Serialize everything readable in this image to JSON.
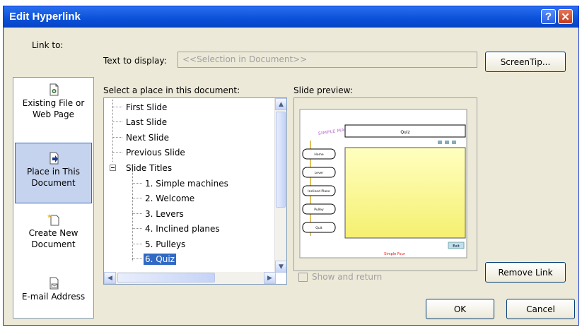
{
  "window": {
    "title": "Edit Hyperlink",
    "help_glyph": "?",
    "close_glyph": "✕"
  },
  "link_to": {
    "label": "Link to:",
    "items": [
      {
        "label_line1": "Existing File or",
        "label_line2": "Web Page",
        "icon": "existing-file-icon",
        "selected": false
      },
      {
        "label_line1": "Place in This",
        "label_line2": "Document",
        "icon": "place-in-document-icon",
        "selected": true
      },
      {
        "label_line1": "Create New",
        "label_line2": "Document",
        "icon": "new-document-icon",
        "selected": false
      },
      {
        "label_line1": "E-mail Address",
        "label_line2": "",
        "icon": "email-icon",
        "selected": false
      }
    ]
  },
  "text_to_display": {
    "label": "Text to display:",
    "value": "<<Selection in Document>>"
  },
  "screentip_label": "ScreenTip...",
  "place": {
    "label": "Select a place in this document:",
    "items": [
      {
        "text": "First Slide",
        "selected": false
      },
      {
        "text": "Last Slide",
        "selected": false
      },
      {
        "text": "Next Slide",
        "selected": false
      },
      {
        "text": "Previous Slide",
        "selected": false
      },
      {
        "text": "Slide Titles",
        "selected": false
      },
      {
        "text": "1. Simple machines",
        "selected": false
      },
      {
        "text": "2. Welcome",
        "selected": false
      },
      {
        "text": "3. Levers",
        "selected": false
      },
      {
        "text": "4. Inclined planes",
        "selected": false
      },
      {
        "text": "5. Pulleys",
        "selected": false
      },
      {
        "text": "6. Quiz",
        "selected": true
      }
    ]
  },
  "preview": {
    "label": "Slide preview:",
    "slide_title": "Quiz",
    "nav_buttons": [
      "Home",
      "Lever",
      "Inclined Plane",
      "Pulley",
      "Quit"
    ],
    "exit_label": "Exit",
    "footer_text": "Simple Four",
    "logo_text": "SIMPLE MACHINES",
    "colors": {
      "panel_top": "#ffffc0",
      "panel_bottom": "#f5f070",
      "footer": "#e81010",
      "logo": "#d0a0e0"
    }
  },
  "show_and_return": {
    "label": "Show and return",
    "checked": false,
    "enabled": false
  },
  "buttons": {
    "remove_link": "Remove Link",
    "ok": "OK",
    "cancel": "Cancel"
  },
  "colors": {
    "dialog_bg": "#ece9d8",
    "title_bar": "#0a50d8",
    "selection": "#316ac5"
  }
}
